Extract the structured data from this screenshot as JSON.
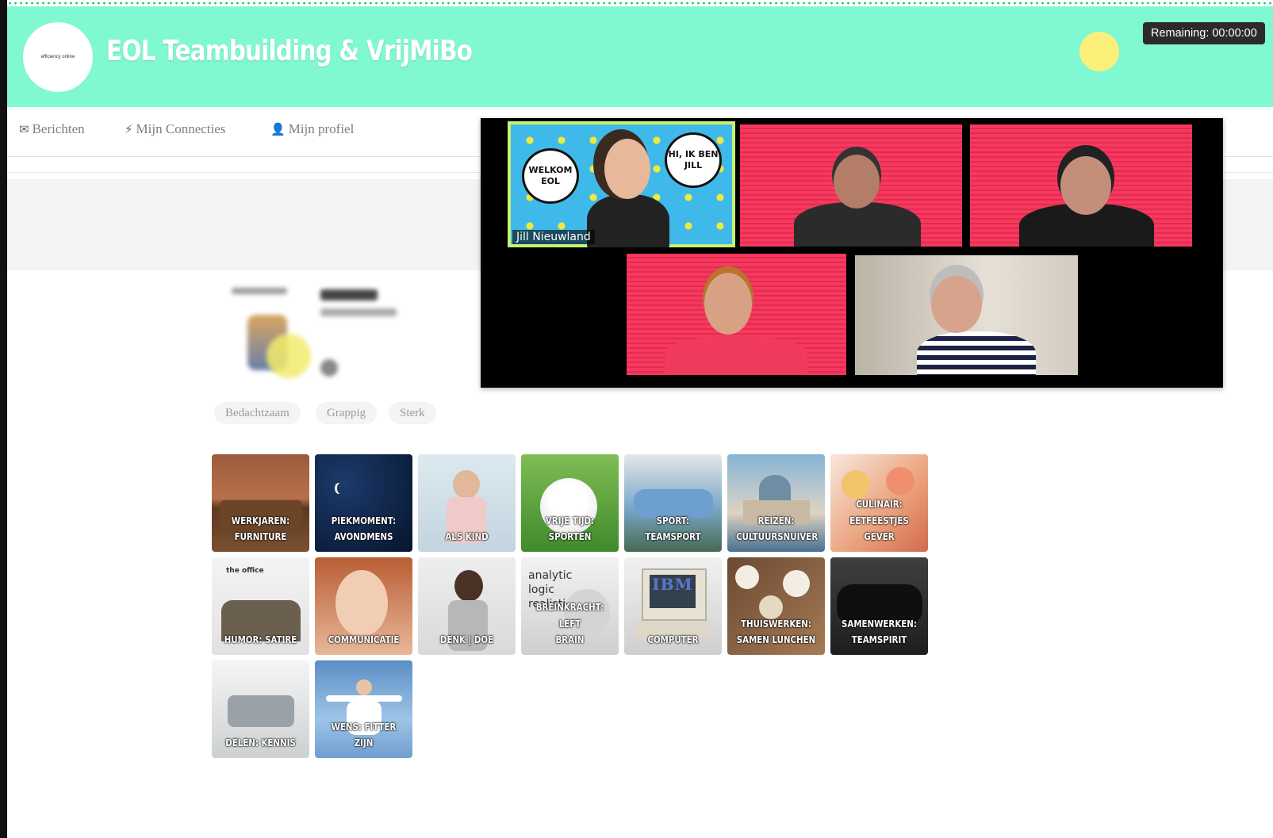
{
  "header": {
    "logo_text": "efficiency online",
    "title": "EOL Teambuilding & VrijMiBo",
    "timer": "Remaining: 00:00:00"
  },
  "nav": [
    {
      "label": "Berichten",
      "icon": "envelope-icon"
    },
    {
      "label": "Mijn Connecties",
      "icon": "lightning-icon"
    },
    {
      "label": "Mijn profiel",
      "icon": "user-icon"
    }
  ],
  "profile": {
    "tags": [
      "Bedachtzaam",
      "Grappig",
      "Sterk"
    ]
  },
  "video_call": {
    "participant_name": "Jill Nieuwland",
    "bubble_left": "WELKOM\nEOL",
    "bubble_right": "HI, IK BEN\nJILL"
  },
  "interest_cards": [
    {
      "label": "WERKJAREN:\nFURNITURE"
    },
    {
      "label": "PIEKMOMENT:\nAVONDMENS"
    },
    {
      "label": "ALS KIND"
    },
    {
      "label": "VRIJE TIJD:\nSPORTEN"
    },
    {
      "label": "SPORT: TEAMSPORT"
    },
    {
      "label": "REIZEN:\nCULTUURSNUIVER"
    },
    {
      "label": "CULINAIR:\nEETFEESTJES GEVER"
    },
    {
      "label": "HUMOR: SATIRE",
      "overlay": "the office"
    },
    {
      "label": "COMMUNICATIE"
    },
    {
      "label": "DENK | DOE"
    },
    {
      "label": "BREINKRACHT: LEFT\nBRAIN",
      "overlay": "analytic\nlogic\nrealistic"
    },
    {
      "label": "COMPUTER",
      "overlay": "IBM"
    },
    {
      "label": "THUISWERKEN:\nSAMEN LUNCHEN"
    },
    {
      "label": "SAMENWERKEN:\nTEAMSPIRIT"
    },
    {
      "label": "DELEN: KENNIS"
    },
    {
      "label": "WENS: FITTER ZIJN"
    }
  ]
}
